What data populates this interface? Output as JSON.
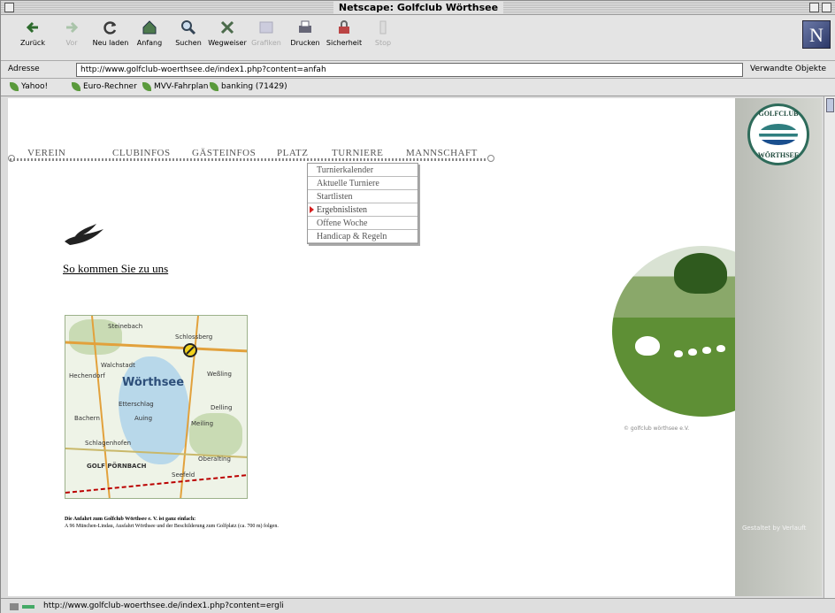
{
  "window": {
    "title": "Netscape: Golfclub Wörthsee"
  },
  "toolbar": {
    "buttons": [
      {
        "label": "Zurück",
        "icon": "back-arrow-icon"
      },
      {
        "label": "Vor",
        "icon": "forward-arrow-icon"
      },
      {
        "label": "Neu laden",
        "icon": "reload-icon"
      },
      {
        "label": "Anfang",
        "icon": "home-icon"
      },
      {
        "label": "Suchen",
        "icon": "search-icon"
      },
      {
        "label": "Wegweiser",
        "icon": "guide-icon"
      },
      {
        "label": "Grafiken",
        "icon": "images-icon"
      },
      {
        "label": "Drucken",
        "icon": "print-icon"
      },
      {
        "label": "Sicherheit",
        "icon": "security-icon"
      },
      {
        "label": "Stop",
        "icon": "stop-icon"
      }
    ],
    "logo": "N"
  },
  "address": {
    "label": "Adresse",
    "url": "http://www.golfclub-woerthsee.de/index1.php?content=anfah",
    "related": "Verwandte Objekte"
  },
  "bookmarks": [
    "Yahoo!",
    "Euro-Rechner",
    "MVV-Fahrplan",
    "banking (71429)"
  ],
  "nav": {
    "items": [
      "VEREIN",
      "CLUBINFOS",
      "GÄSTEINFOS",
      "PLATZ",
      "TURNIERE",
      "MANNSCHAFT"
    ],
    "dropdown": [
      "Turnierkalender",
      "Aktuelle Turniere",
      "Startlisten",
      "Ergebnislisten",
      "Offene Woche",
      "Handicap & Regeln"
    ],
    "dropdown_selected": "Ergebnislisten"
  },
  "logo": {
    "top": "GOLFCLUB",
    "bottom": "WÖRTHSEE"
  },
  "main": {
    "route_link": "So kommen Sie zu uns",
    "desc_title": "Die Anfahrt zum Golfclub Wörthsee e. V. ist ganz einfach:",
    "desc_text": "A 96 München-Lindau, Ausfahrt Wörthsee und der Beschilderung zum Golfplatz (ca. 700 m) folgen.",
    "photo_caption": "© golfclub wörthsee e.V.",
    "sidebar_credit": "Gestaltet by Verlauft"
  },
  "map": {
    "labels": [
      "Steinebach",
      "Schlossberg",
      "Walchstadt",
      "Wörthsee",
      "Etterschlag",
      "Bachern",
      "Auing",
      "Schlagenhofen",
      "Meiling",
      "Seefeld",
      "Oberalting",
      "Delling",
      "Weßling",
      "Hechendorf"
    ],
    "center_label": "Wörthsee",
    "golf_label": "GOLF PÖRNBACH"
  },
  "status": {
    "text": "http://www.golfclub-woerthsee.de/index1.php?content=ergli"
  }
}
